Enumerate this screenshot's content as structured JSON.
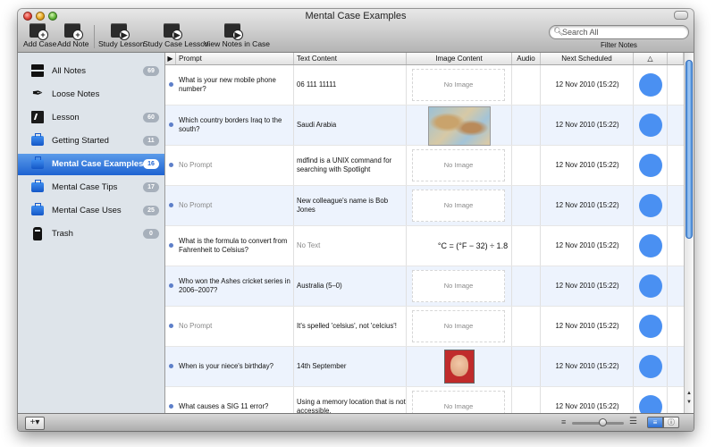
{
  "window": {
    "title": "Mental Case Examples"
  },
  "toolbar": {
    "buttons": [
      {
        "label": "Add Case",
        "icon": "add-case-icon",
        "glyph": "+"
      },
      {
        "label": "Add Note",
        "icon": "add-note-icon",
        "glyph": "+"
      },
      {
        "label": "Study Lesson",
        "icon": "study-lesson-icon",
        "glyph": "▶"
      },
      {
        "label": "Study Case Lesson",
        "icon": "study-case-lesson-icon",
        "glyph": "▶"
      },
      {
        "label": "View Notes in Case",
        "icon": "view-notes-icon",
        "glyph": "▶"
      }
    ],
    "search_placeholder": "Search All",
    "filter_label": "Filter Notes"
  },
  "sidebar": {
    "items": [
      {
        "label": "All Notes",
        "count": "69",
        "icon": "all-notes-icon"
      },
      {
        "label": "Loose Notes",
        "count": "",
        "icon": "quill-icon"
      },
      {
        "label": "Lesson",
        "count": "60",
        "icon": "lesson-icon"
      },
      {
        "label": "Getting Started",
        "count": "11",
        "icon": "case-icon"
      },
      {
        "label": "Mental Case Examples",
        "count": "16",
        "icon": "case-icon",
        "selected": true
      },
      {
        "label": "Mental Case Tips",
        "count": "17",
        "icon": "case-icon"
      },
      {
        "label": "Mental Case Uses",
        "count": "25",
        "icon": "case-icon"
      },
      {
        "label": "Trash",
        "count": "0",
        "icon": "trash-icon"
      }
    ]
  },
  "table": {
    "columns": {
      "expand": "▶",
      "prompt": "Prompt",
      "text": "Text Content",
      "image": "Image Content",
      "audio": "Audio",
      "next": "Next Scheduled",
      "delta": "△"
    },
    "rows": [
      {
        "prompt": "What is your new mobile phone number?",
        "prompt_muted": false,
        "text": "06 111 11111",
        "text_muted": false,
        "image": "No Image",
        "image_type": "none",
        "next": "12 Nov 2010 (15:22)"
      },
      {
        "prompt": "Which country borders Iraq to the south?",
        "prompt_muted": false,
        "text": "Saudi Arabia",
        "text_muted": false,
        "image": "",
        "image_type": "map",
        "next": "12 Nov 2010 (15:22)"
      },
      {
        "prompt": "No Prompt",
        "prompt_muted": true,
        "text": "mdfind is a UNIX command for searching with Spotlight",
        "text_muted": false,
        "image": "No Image",
        "image_type": "none",
        "next": "12 Nov 2010 (15:22)"
      },
      {
        "prompt": "No Prompt",
        "prompt_muted": true,
        "text": "New colleague's name is Bob Jones",
        "text_muted": false,
        "image": "No Image",
        "image_type": "none",
        "next": "12 Nov 2010 (15:22)"
      },
      {
        "prompt": "What is the formula to convert from Fahrenheit to Celsius?",
        "prompt_muted": false,
        "text": "No Text",
        "text_muted": true,
        "image": "°C = (°F − 32) ÷ 1.8",
        "image_type": "formula",
        "next": "12 Nov 2010 (15:22)"
      },
      {
        "prompt": "Who won the Ashes cricket series in 2006–2007?",
        "prompt_muted": false,
        "text": "Australia (5–0)",
        "text_muted": false,
        "image": "No Image",
        "image_type": "none",
        "next": "12 Nov 2010 (15:22)"
      },
      {
        "prompt": "No Prompt",
        "prompt_muted": true,
        "text": "It's spelled 'celsius', not 'celcius'!",
        "text_muted": false,
        "image": "No Image",
        "image_type": "none",
        "next": "12 Nov 2010 (15:22)"
      },
      {
        "prompt": "When is your niece's birthday?",
        "prompt_muted": false,
        "text": "14th September",
        "text_muted": false,
        "image": "",
        "image_type": "photo",
        "next": "12 Nov 2010 (15:22)"
      },
      {
        "prompt": "What causes a SIG 11 error?",
        "prompt_muted": false,
        "text": "Using a memory location that is not accessible.",
        "text_muted": false,
        "image": "No Image",
        "image_type": "none",
        "next": "12 Nov 2010 (15:22)"
      }
    ]
  },
  "bottombar": {
    "add_label": "+▾",
    "slider_value": 0.6
  },
  "colors": {
    "accent": "#1e63d2",
    "strength_circle": "#4a90f2"
  }
}
